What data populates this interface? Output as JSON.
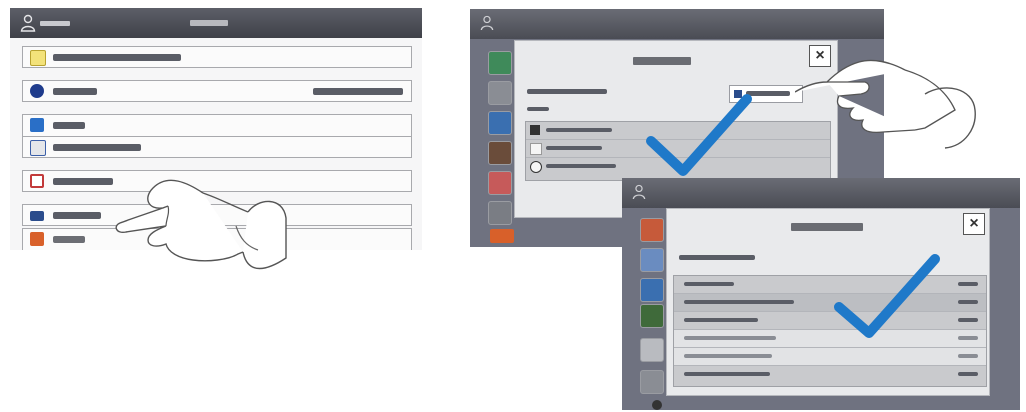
{
  "colors": {
    "check": "#1f79c9",
    "header": "#4a4c54",
    "dialog_bg": "#e9eaec",
    "icon_yellow": "#e8c21c",
    "icon_blue_dark": "#1f3c8c",
    "icon_blue": "#2a6fc7",
    "icon_red": "#c23a3a",
    "icon_orange": "#d8602a"
  },
  "left_panel": {
    "rows": [
      {
        "icon": "folder-icon",
        "color": "#e8c21c"
      },
      {
        "icon": "globe-icon",
        "color": "#1f3c8c"
      },
      {
        "icon": "app-icon",
        "color": "#2a6fc7"
      },
      {
        "icon": "copy-icon",
        "color": "#3b5fa8"
      },
      {
        "icon": "print-icon",
        "color": "#c23a3a"
      },
      {
        "icon": "factory-icon",
        "color": "#2a4c8c"
      },
      {
        "icon": "email-icon",
        "color": "#d8602a"
      }
    ]
  },
  "dialog_top": {
    "close_label": "×",
    "icons": [
      "check-icon",
      "pointing-hand-icon"
    ]
  },
  "dialog_bottom": {
    "close_label": "×",
    "icons": [
      "check-icon"
    ]
  }
}
